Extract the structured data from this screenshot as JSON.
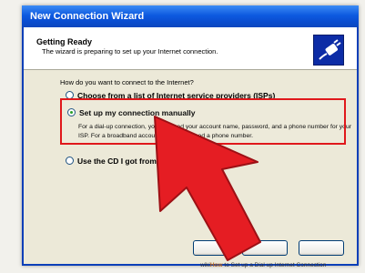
{
  "window": {
    "title": "New Connection Wizard"
  },
  "header": {
    "title": "Getting Ready",
    "subtitle": "The wizard is preparing to set up your Internet connection."
  },
  "question": "How do you want to connect to the Internet?",
  "options": [
    {
      "label": "Choose from a list of Internet service providers (ISPs)",
      "selected": false
    },
    {
      "label": "Set up my connection manually",
      "selected": true,
      "description": "For a dial-up connection, you will need your account name, password, and a phone number for your ISP. For a broadband account, you won't need a phone number."
    },
    {
      "label": "Use the CD I got from an ISP",
      "selected": false
    }
  ],
  "caption": {
    "brand": "wiki",
    "brand_bold": "How",
    "text": "to Set up a Dial up Internet Connection"
  },
  "colors": {
    "titlebar": "#0a4ccf",
    "highlight": "#e0181b",
    "arrow": "#e51d23"
  },
  "icons": [
    "connection-plug-icon",
    "pointer-arrow-icon"
  ]
}
